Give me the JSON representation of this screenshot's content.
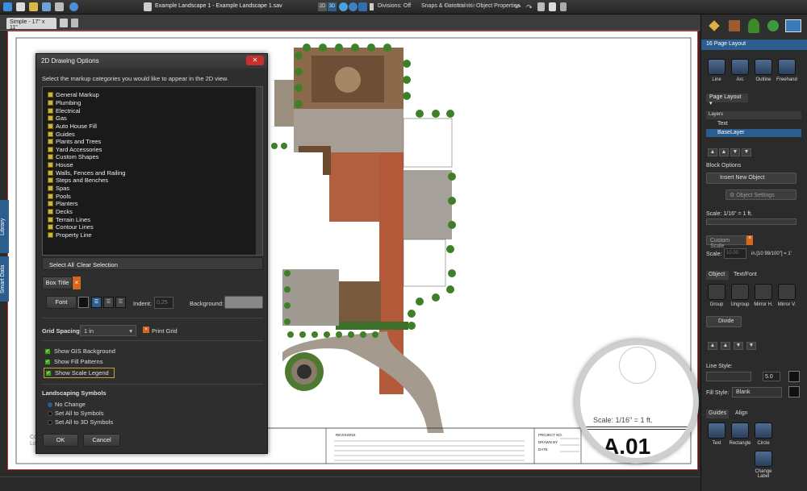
{
  "app": {
    "title": "Example Landscape 1 - Example Landscape 1.sav"
  },
  "toolbar": {
    "divisions": "Divisions: Off",
    "snaps": "Snaps & Constraints",
    "hide_unhide": "Hide/Unhide",
    "object_properties": "Object Properties",
    "view_2d": "2D",
    "view_3d": "3D"
  },
  "tab": {
    "label": "Simple - 17\" x 11\""
  },
  "side_tabs": {
    "library": "Library",
    "smart_data": "Smart Data"
  },
  "dialog": {
    "title": "2D Drawing Options",
    "instruction": "Select the markup categories you would like to appear in the 2D view.",
    "categories": [
      "General Markup",
      "Plumbing",
      "Electrical",
      "Gas",
      "Auto House Fill",
      "Guides",
      "Plants and Trees",
      "Yard Accessories",
      "Custom Shapes",
      "House",
      "Walls, Fences and Railing",
      "Steps and Benches",
      "Spas",
      "Pools",
      "Planters",
      "Decks",
      "Terrain Lines",
      "Contour Lines",
      "Property Line"
    ],
    "select_all": "Select All",
    "clear_selection": "Clear Selection",
    "box_title": "Box Title",
    "font_label": "Font",
    "indent_label": "Indent:",
    "indent_value": "0.25",
    "background_label": "Background:",
    "grid_spacing_label": "Grid Spacing",
    "grid_spacing_value": "1 in",
    "print_grid": "Print Grid",
    "show_gis": "Show GIS Background",
    "show_fill": "Show Fill Patterns",
    "show_scale": "Show Scale Legend",
    "landscaping_symbols": "Landscaping Symbols",
    "no_change": "No Change",
    "set_symbols": "Set All to Symbols",
    "set_3d": "Set All to 3D Symbols",
    "ok": "OK",
    "cancel": "Cancel"
  },
  "titleblock": {
    "revisions": "REVISIONS",
    "project_no": "PROJECT NO.",
    "drawn_by": "DRAWN BY",
    "date": "DATE"
  },
  "magnifier": {
    "scale": "Scale: 1/16\" = 1 ft.",
    "sheet": "A.01"
  },
  "canvas_text": {
    "left_c": "Co",
    "left_l": "Lo"
  },
  "right_panel": {
    "header": "16 Page Layout",
    "tools": [
      "Line",
      "Arc",
      "Outline",
      "Freehand"
    ],
    "page_layout_tab": "Page Layout",
    "layers_label": "Layers",
    "layers": [
      "Text",
      "BaseLayer"
    ],
    "block_options": "Block Options",
    "insert_new_object": "Insert New Object",
    "object_settings": "Object Settings",
    "scale_label": "Scale: 1/16\" = 1 ft.",
    "custom_scale": "Custom Scale",
    "scale_field_label": "Scale:",
    "scale_field_value": "10.00",
    "scale_unit": "in.[10 99/100\"] = 1'",
    "tabs_obj": [
      "Object",
      "Text/Font"
    ],
    "obj_tools": [
      "Group",
      "Ungroup",
      "Mirror H.",
      "Mirror V."
    ],
    "divide": "Divide",
    "line_style": "Line Style:",
    "line_width": "5.0",
    "fill_style": "Fill Style:",
    "fill_value": "Blank",
    "tabs_guides": [
      "Guides",
      "Align"
    ],
    "guide_tools": [
      "Text",
      "Rectangle",
      "Circle"
    ],
    "change_label": "Change Label"
  },
  "colors": {
    "accent": "#2c5d8f",
    "panel": "#2b2b2b",
    "close": "#c9302c",
    "checkbox": "#c8b53a"
  }
}
